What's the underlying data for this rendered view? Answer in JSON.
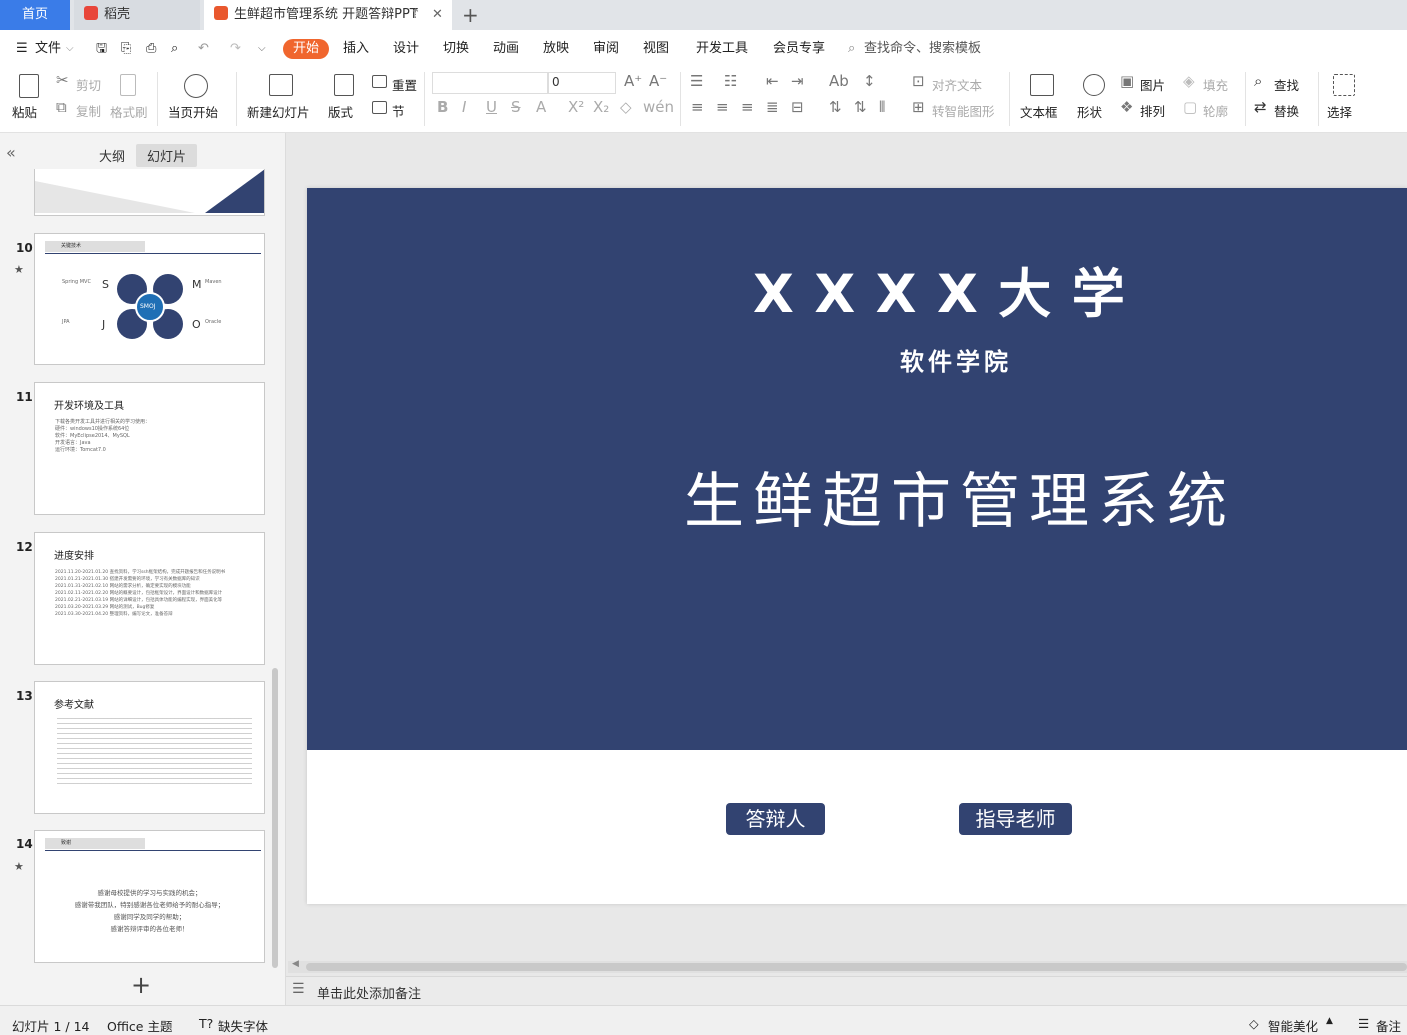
{
  "tabs": {
    "home": "首页",
    "daoke": "稻壳",
    "document": "生鲜超市管理系统 开题答辩PPT",
    "new_tab": "+"
  },
  "menu": {
    "file": "文件",
    "items": [
      "开始",
      "插入",
      "设计",
      "切换",
      "动画",
      "放映",
      "审阅",
      "视图",
      "开发工具",
      "会员专享"
    ],
    "search_placeholder": "查找命令、搜索模板"
  },
  "ribbon": {
    "paste": "粘贴",
    "cut": "剪切",
    "copy": "复制",
    "format_painter": "格式刷",
    "from_current": "当页开始",
    "new_slide": "新建幻灯片",
    "layout": "版式",
    "reset": "重置",
    "section": "节",
    "font_size": "0",
    "align_text": "对齐文本",
    "smart_art": "转智能图形",
    "text_box": "文本框",
    "shape": "形状",
    "picture": "图片",
    "arrange": "排列",
    "fill": "填充",
    "outline": "轮廓",
    "find": "查找",
    "replace": "替换",
    "select": "选择"
  },
  "panel": {
    "outline_tab": "大纲",
    "slides_tab": "幻灯片",
    "add": "+"
  },
  "thumbnails": [
    {
      "num": "10",
      "title": "关键技术",
      "center": "SMOJ",
      "letters": [
        "S",
        "M",
        "J",
        "O"
      ],
      "labels": [
        "Spring MVC",
        "Maven",
        "JPA",
        "Oracle"
      ]
    },
    {
      "num": "11",
      "title": "开发环境及工具",
      "lines": [
        "下载各类开发工具并进行相关的学习使用：",
        "硬件：windows10操作系统64位",
        "软件：MyEclipse2014、MySQL",
        "开发语言：Java",
        "运行环境：Tomcat7.0"
      ]
    },
    {
      "num": "12",
      "title": "进度安排",
      "lines": [
        "2021.11.20-2021.01.20 查找资料，学习ssh框架结构，完成开题报告和任务说明书",
        "2021.01.21-2021.01.30 搭建开发需要的环境，学习有关数据库的知识",
        "2021.01.31-2021.02.10 网站的需求分析，确定要实现的模块功能",
        "2021.02.11-2021.02.20 网站的概要设计，包括框架设计，界面设计和数据库设计",
        "2021.02.21-2021.03.19 网站的详细设计，包括具体功能的编程实现，界面美化等",
        "2021.03.20-2021.03.29 网站的测试，Bug修复",
        "2021.03.30-2021.04.20 整理资料，编写论文，准备答辩"
      ]
    },
    {
      "num": "13",
      "title": "参考文献"
    },
    {
      "num": "14",
      "title": "致谢",
      "lines": [
        "感谢母校提供的学习与实践的机会；",
        "感谢带我团队，特别感谢各位老师给予的耐心指导；",
        "感谢同学及同学的帮助；",
        "感谢答辩评审的各位老师！"
      ]
    }
  ],
  "slide": {
    "university": "X X X X 大 学",
    "college": "软件学院",
    "title": "生鲜超市管理系统",
    "defender_label": "答辩人",
    "advisor_label": "指导老师"
  },
  "notes_placeholder": "单击此处添加备注",
  "status": {
    "slide_index": "幻灯片 1 / 14",
    "theme": "Office 主题",
    "missing_font": "缺失字体",
    "beautify": "智能美化",
    "notes": "备注"
  },
  "colors": {
    "slide_band": "#324371",
    "accent": "#f0662e",
    "home_tab": "#3a7ce8"
  }
}
